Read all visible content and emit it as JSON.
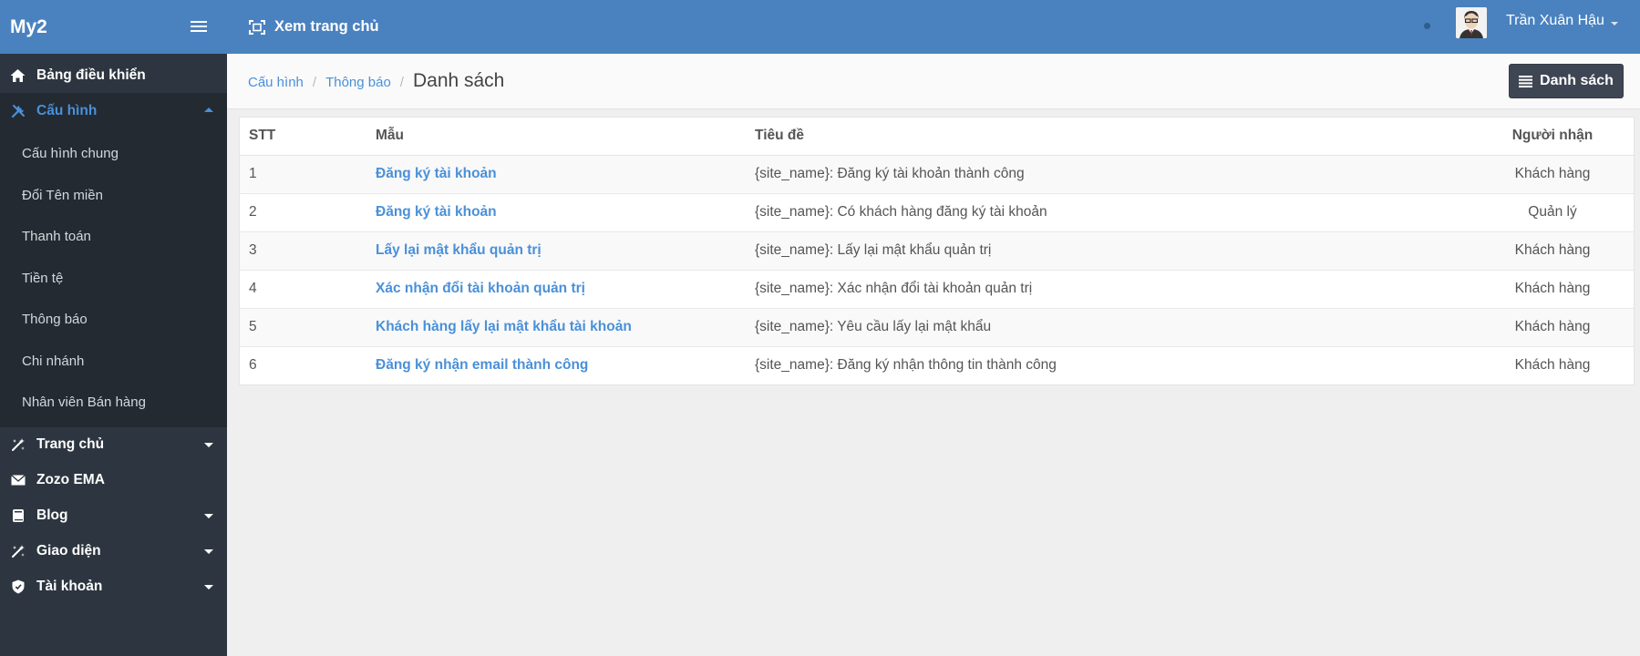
{
  "sidebar": {
    "brand": "My2",
    "items": [
      {
        "label": "Bảng điều khiển",
        "icon": "home-icon"
      },
      {
        "label": "Cấu hình",
        "icon": "tools-icon",
        "active": true,
        "children": [
          "Cấu hình chung",
          "Đổi Tên miền",
          "Thanh toán",
          "Tiền tệ",
          "Thông báo",
          "Chi nhánh",
          "Nhân viên Bán hàng"
        ]
      },
      {
        "label": "Trang chủ",
        "icon": "magic-wand-icon"
      },
      {
        "label": "Zozo EMA",
        "icon": "envelope-icon"
      },
      {
        "label": "Blog",
        "icon": "book-icon"
      },
      {
        "label": "Giao diện",
        "icon": "magic-wand-icon"
      },
      {
        "label": "Tài khoản",
        "icon": "shield-icon"
      }
    ]
  },
  "header": {
    "home_link": "Xem trang chủ",
    "user_name": "Trần Xuân Hậu"
  },
  "breadcrumb": {
    "items": [
      "Cấu hình",
      "Thông báo"
    ],
    "current": "Danh sách"
  },
  "toolbar": {
    "list_button": "Danh sách"
  },
  "table": {
    "headers": [
      "STT",
      "Mẫu",
      "Tiêu đề",
      "Người nhận"
    ],
    "rows": [
      [
        "1",
        "Đăng ký tài khoản",
        "{site_name}: Đăng ký tài khoản thành công",
        "Khách hàng"
      ],
      [
        "2",
        "Đăng ký tài khoản",
        "{site_name}: Có khách hàng đăng ký tài khoản",
        "Quản lý"
      ],
      [
        "3",
        "Lấy lại mật khẩu quản trị",
        "{site_name}: Lấy lại mật khẩu quản trị",
        "Khách hàng"
      ],
      [
        "4",
        "Xác nhận đổi tài khoản quản trị",
        "{site_name}: Xác nhận đổi tài khoản quản trị",
        "Khách hàng"
      ],
      [
        "5",
        "Khách hàng lấy lại mật khẩu tài khoản",
        "{site_name}: Yêu cầu lấy lại mật khẩu",
        "Khách hàng"
      ],
      [
        "6",
        "Đăng ký nhận email thành công",
        "{site_name}: Đăng ký nhận thông tin thành công",
        "Khách hàng"
      ]
    ]
  },
  "colors": {
    "primary": "#4a82bf",
    "link": "#4a90d9",
    "sidebar": "#2d3640",
    "sidebar_active": "#232a32"
  }
}
